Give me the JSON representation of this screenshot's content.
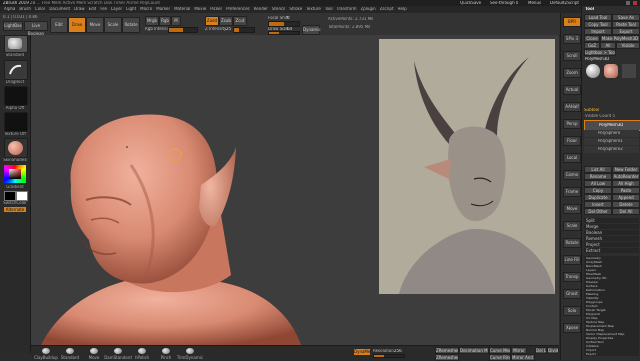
{
  "title_bar": {
    "app": "ZBrush 2019",
    "tool_info": "ZB ...  Free Mem  Active Mem  Scratch Disk  Timer  ATime  PolyCount",
    "quick_save": "QuickSave",
    "see_through": "See-through 0",
    "menus_label": "Menus",
    "default_script": "DefaultZScript"
  },
  "menu_bar": {
    "items": [
      "Alpha",
      "Brush",
      "Color",
      "Document",
      "Draw",
      "Edit",
      "File",
      "Layer",
      "Light",
      "Macro",
      "Marker",
      "Material",
      "Movie",
      "Picker",
      "Preferences",
      "Render",
      "Stencil",
      "Stroke",
      "Texture",
      "Tool",
      "Transform",
      "Zplugin",
      "Zscript",
      "Help"
    ]
  },
  "toolbar": {
    "coords": "0.1 | 0.031 | 0.86",
    "lightbox": "LightBox",
    "live_boolean": "Live Boolean",
    "edit": "Edit",
    "draw": "Draw",
    "move": "Move",
    "scale": "Scale",
    "rotate": "Rotate",
    "mrgb": "Mrgb",
    "rgb": "Rgb",
    "m": "M",
    "zadd": "Zadd",
    "zsub": "Zsub",
    "zcut": "Zcut",
    "rgb_intensity_label": "Rgb Intensity",
    "z_intensity_label": "Z Intensity",
    "z_intensity_value": "25",
    "focal_shift_label": "Focal Shift",
    "focal_shift_value": "0",
    "draw_size_label": "Draw Size",
    "draw_size_value": "64",
    "dynamic_label": "Dynamic",
    "active_points": "ActivePoints: 2.731 Mil",
    "total_points": "TotalPoints: 2.895 Mil",
    "rgb_intensity": 0.5,
    "z_intensity": 0.25,
    "focal_shift": 0.5,
    "draw_size": 0.34
  },
  "left_shelf": {
    "brush_name": "Standard",
    "stroke_name": "DragRect",
    "alpha_name": "Alpha Off",
    "texture_name": "Texture Off",
    "material_name": "SkinShade4",
    "gradient_label": "Gradient",
    "switch_color": "SwitchColor",
    "alternate": "Alternate"
  },
  "viewport": {
    "reference_description": "Horned character concept painting"
  },
  "bottom_bar": {
    "brushes": [
      "ClayBuildup",
      "Standard",
      "Move",
      "DamStandard",
      "hPolish",
      "Pinch",
      "TrimDynamic"
    ],
    "dynamesh": "DynaMesh",
    "resolution_label": "Resolution",
    "resolution_value": "256",
    "zremesher": "ZRemesher",
    "zremesher_guide": "ZRemesherGuide",
    "decimation": "Decimation Master",
    "curve_mode": "Curve Mode",
    "curve_ring": "Curve Ring",
    "mirror": "Mirror",
    "mirror_weld": "Mirror And Weld",
    "del_lower": "Del Lower",
    "del_higher": "Del Higher",
    "divide": "Divide"
  },
  "right_shelf": {
    "items": [
      "BPR",
      "SPix 3",
      "Scroll",
      "Zoom",
      "Actual",
      "AAHalf",
      "Persp",
      "Floor",
      "Local",
      "Gizmo",
      "Frame",
      "Move",
      "Scale",
      "Rotate",
      "Line Fill",
      "Transp",
      "Ghost",
      "Solo",
      "Xpose"
    ]
  },
  "tool_panel": {
    "header": "Tool",
    "load_tool": "Load Tool",
    "save_as": "Save As",
    "copy_tool": "Copy Tool",
    "paste_tool": "Paste Tool",
    "import": "Import",
    "export": "Export",
    "clone": "Clone",
    "make_polymesh": "Make PolyMesh3D",
    "goz": "GoZ",
    "all": "All",
    "visible": "Visible",
    "lightbox_tools": "Lightbox > Tools",
    "current_tool": "PolyMesh3D",
    "subtool_header": "Subtool",
    "visible_count": "Visible Count 5",
    "subtools": [
      "PolyMesh3D",
      "PolySphere",
      "PolySphere1",
      "PolySphere2"
    ],
    "list_all": "List All",
    "new_folder": "New Folder",
    "rename": "Rename",
    "auto_reorder": "AutoReorder",
    "all_low": "All Low",
    "all_high": "All High",
    "copy": "Copy",
    "paste": "Paste",
    "duplicate": "Duplicate",
    "append": "Append",
    "insert": "Insert",
    "delete": "Delete",
    "del_other": "Del Other",
    "del_all": "Del All",
    "split": "Split",
    "merge": "Merge",
    "boolean": "Boolean",
    "remesh": "Remesh",
    "project": "Project",
    "extract": "Extract",
    "sections": [
      "Geometry",
      "ArrayMesh",
      "NanoMesh",
      "Layers",
      "FiberMesh",
      "Geometry HD",
      "Preview",
      "Surface",
      "Deformation",
      "Masking",
      "Visibility",
      "Polygroups",
      "Contact",
      "Morph Target",
      "Polypaint",
      "UV Map",
      "Texture Map",
      "Displacement Map",
      "Normal Map",
      "Vector Displacement Map",
      "Display Properties",
      "Unified Skin",
      "Initialize",
      "Import",
      "Export"
    ]
  },
  "colors": {
    "accent": "#d9801a",
    "section": "#f0c04a",
    "panel_bg": "#2e2e2e",
    "viewport_bg": "#3d3d3d",
    "sculpt_skin": "#d98a72"
  }
}
